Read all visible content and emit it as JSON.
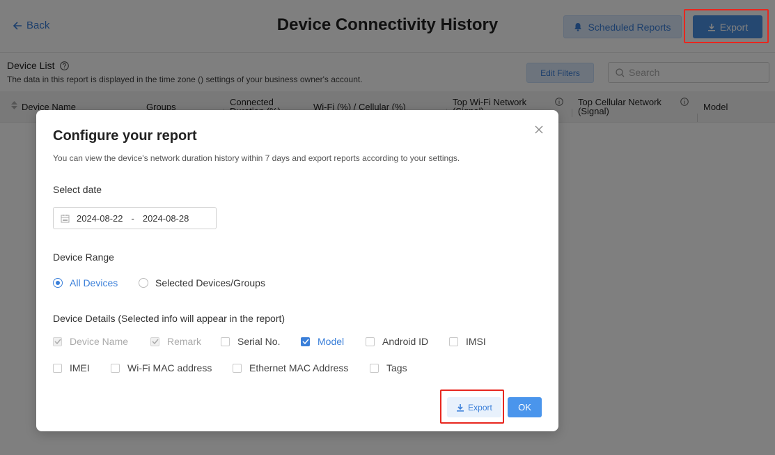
{
  "header": {
    "back_label": "Back",
    "title": "Device Connectivity History",
    "scheduled_reports_label": "Scheduled Reports",
    "export_label": "Export"
  },
  "list": {
    "title": "Device List",
    "subtitle": "The data in this report is displayed in the time zone () settings of your business owner's account.",
    "edit_filters_label": "Edit Filters",
    "search_placeholder": "Search"
  },
  "table": {
    "columns": {
      "device_name": "Device Name",
      "groups": "Groups",
      "connected_duration": "Connected Duration (%)",
      "wifi_cellular": "Wi-Fi (%) / Cellular (%)",
      "top_wifi": "Top Wi-Fi Network (Signal)",
      "top_cellular": "Top Cellular Network (Signal)",
      "model": "Model"
    }
  },
  "modal": {
    "title": "Configure your report",
    "description": "You can view the device's network duration history within 7 days and export reports according to your settings.",
    "select_date_label": "Select date",
    "date_start": "2024-08-22",
    "date_separator": "-",
    "date_end": "2024-08-28",
    "device_range_label": "Device Range",
    "range_all": "All Devices",
    "range_selected": "Selected Devices/Groups",
    "range_value": "All Devices",
    "details_label": "Device Details (Selected info will appear in the report)",
    "details": [
      {
        "label": "Device Name",
        "checked": true,
        "disabled": true
      },
      {
        "label": "Remark",
        "checked": true,
        "disabled": true
      },
      {
        "label": "Serial No.",
        "checked": false,
        "disabled": false
      },
      {
        "label": "Model",
        "checked": true,
        "disabled": false
      },
      {
        "label": "Android ID",
        "checked": false,
        "disabled": false
      },
      {
        "label": "IMSI",
        "checked": false,
        "disabled": false
      },
      {
        "label": "IMEI",
        "checked": false,
        "disabled": false
      },
      {
        "label": "Wi-Fi MAC address",
        "checked": false,
        "disabled": false
      },
      {
        "label": "Ethernet MAC Address",
        "checked": false,
        "disabled": false
      },
      {
        "label": "Tags",
        "checked": false,
        "disabled": false
      }
    ],
    "export_label": "Export",
    "ok_label": "OK"
  },
  "colors": {
    "accent": "#3a7fd9",
    "primary_button": "#4a95ec",
    "highlight": "#e8271f"
  }
}
